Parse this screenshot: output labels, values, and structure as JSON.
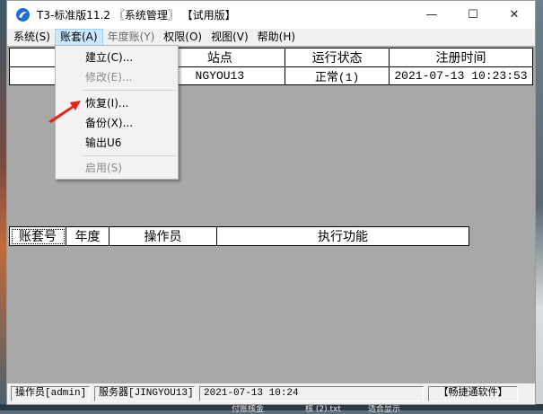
{
  "window": {
    "title": "T3-标准版11.2 〖系统管理〗 【试用版】",
    "controls": {
      "minimize": "—",
      "maximize": "☐",
      "close": "✕"
    }
  },
  "menubar": [
    {
      "label": "系统(S)",
      "state": "normal"
    },
    {
      "label": "账套(A)",
      "state": "active"
    },
    {
      "label": "年度账(Y)",
      "state": "disabled"
    },
    {
      "label": "权限(O)",
      "state": "normal"
    },
    {
      "label": "视图(V)",
      "state": "normal"
    },
    {
      "label": "帮助(H)",
      "state": "normal"
    }
  ],
  "dropdown": {
    "items": [
      {
        "label": "建立(C)...",
        "enabled": true
      },
      {
        "label": "修改(E)...",
        "enabled": false
      },
      {
        "label": "恢复(I)...",
        "enabled": true
      },
      {
        "label": "备份(X)...",
        "enabled": true
      },
      {
        "label": "输出U6",
        "enabled": true
      },
      {
        "label": "启用(S)",
        "enabled": false
      }
    ]
  },
  "upper_table": {
    "headers": [
      "子",
      "站点",
      "运行状态",
      "注册时间"
    ],
    "rows": [
      [
        "",
        "NGYOU13",
        "正常(1)",
        "2021-07-13 10:23:53"
      ]
    ]
  },
  "lower_table": {
    "headers": [
      "账套号",
      "年度",
      "操作员",
      "执行功能"
    ]
  },
  "statusbar": {
    "operator": "操作员[admin]",
    "server": "服务器[JINGYOU13]",
    "datetime": "2021-07-13 10:24",
    "brand": "【畅捷通软件】"
  },
  "taskbar_bits": [
    "付账核金",
    "核 (2).txt",
    "适合显示"
  ],
  "colors": {
    "client_bg": "#a8a8a8",
    "menu_active": "#cce8ff",
    "arrow": "#e8231e"
  }
}
